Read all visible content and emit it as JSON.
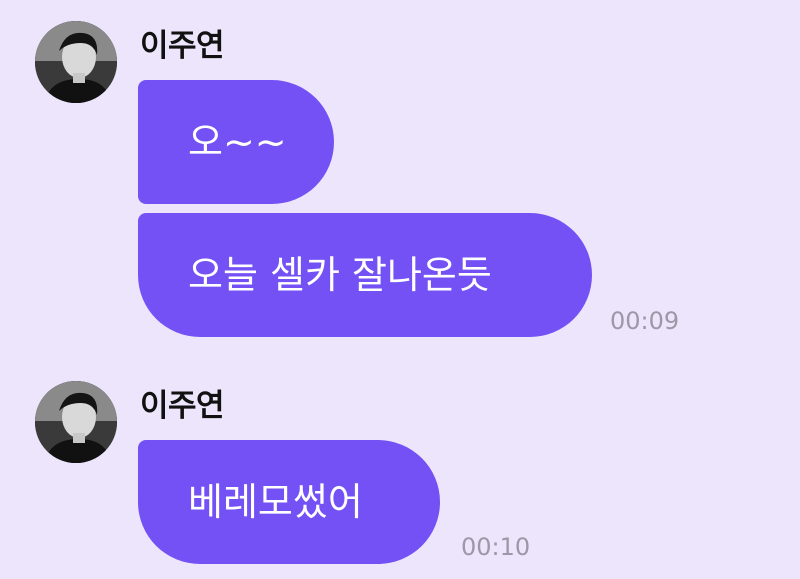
{
  "theme": {
    "background": "#ece5fb",
    "bubble_color": "#7451f5",
    "bubble_text": "#ffffff",
    "time_color": "#9d98a8"
  },
  "messages": [
    {
      "sender": "이주연",
      "avatar_icon": "profile-photo",
      "bubbles": [
        "오~~",
        "오늘 셀카 잘나온듯"
      ],
      "time": "00:09"
    },
    {
      "sender": "이주연",
      "avatar_icon": "profile-photo",
      "bubbles": [
        "베레모썼어"
      ],
      "time": "00:10"
    }
  ]
}
